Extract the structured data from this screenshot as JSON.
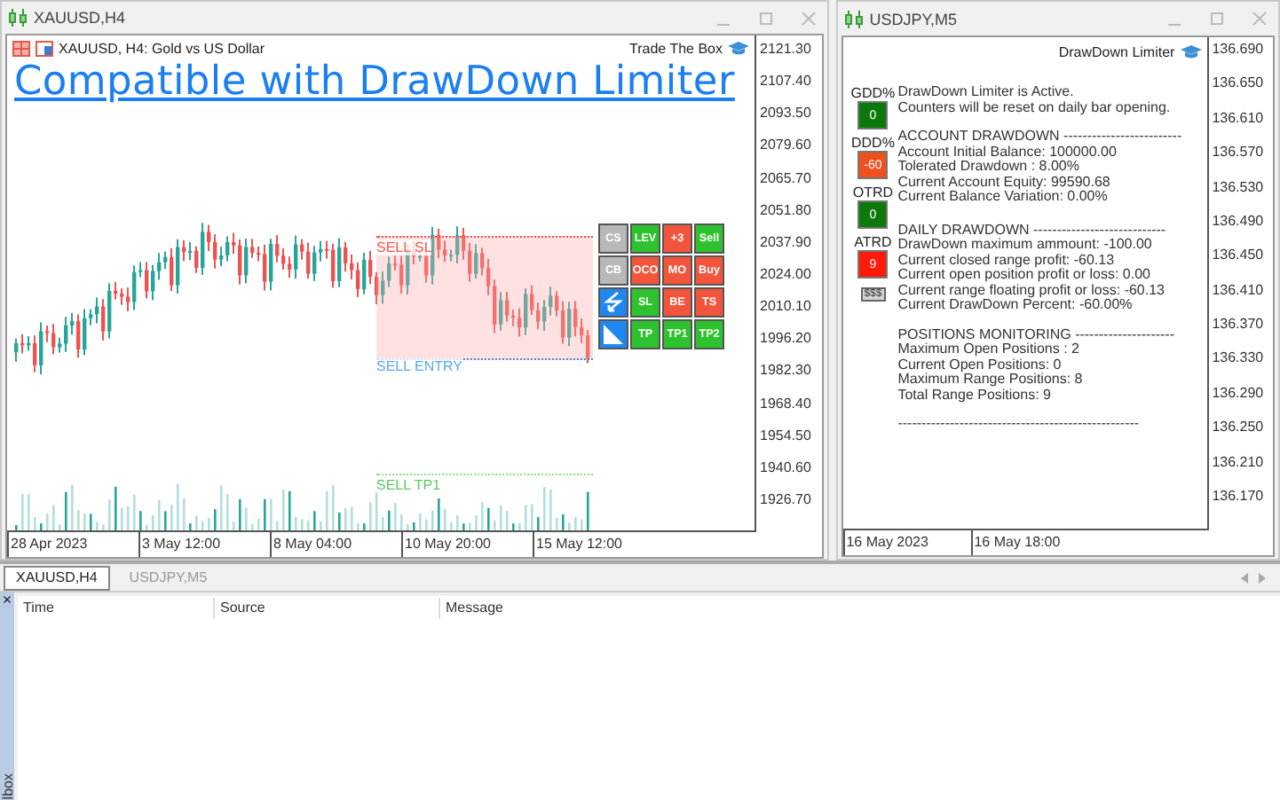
{
  "left_window": {
    "title": "XAUUSD,H4",
    "symbol_info": "XAUUSD, H4:  Gold vs US Dollar",
    "brand": "Trade The Box",
    "banner": "Compatible with DrawDown Limiter",
    "price_axis": [
      "2121.30",
      "2107.40",
      "2093.50",
      "2079.60",
      "2065.70",
      "2051.80",
      "2037.90",
      "2024.00",
      "2010.10",
      "1996.20",
      "1982.30",
      "1968.40",
      "1954.50",
      "1940.60",
      "1926.70"
    ],
    "time_axis": [
      "28 Apr 2023",
      "3 May 12:00",
      "8 May 04:00",
      "10 May 20:00",
      "15 May 12:00"
    ],
    "trade_lines": [
      {
        "label": "SELL SL",
        "kind": "sl"
      },
      {
        "label": "SELL ENTRY",
        "kind": "entry"
      },
      {
        "label": "SELL TP1",
        "kind": "tp"
      }
    ],
    "buttons": [
      {
        "kind": "text",
        "label": "CS",
        "color": "#b8b8b8"
      },
      {
        "kind": "text",
        "label": "LEV",
        "color": "#2ec22e"
      },
      {
        "kind": "text",
        "label": "+3",
        "color": "#f2553c"
      },
      {
        "kind": "text",
        "label": "Sell",
        "color": "#2ec22e"
      },
      {
        "kind": "text",
        "label": "CB",
        "color": "#b8b8b8"
      },
      {
        "kind": "text",
        "label": "OCO",
        "color": "#f2553c"
      },
      {
        "kind": "text",
        "label": "MO",
        "color": "#f2553c"
      },
      {
        "kind": "text",
        "label": "Buy",
        "color": "#f2553c"
      },
      {
        "kind": "zigzag",
        "color": "#1e88f0"
      },
      {
        "kind": "text",
        "label": "SL",
        "color": "#2ec22e"
      },
      {
        "kind": "text",
        "label": "BE",
        "color": "#f2553c"
      },
      {
        "kind": "text",
        "label": "TS",
        "color": "#f2553c"
      },
      {
        "kind": "triangle",
        "color": "#1e88f0"
      },
      {
        "kind": "text",
        "label": "TP",
        "color": "#2ec22e"
      },
      {
        "kind": "text",
        "label": "TP1",
        "color": "#2ec22e"
      },
      {
        "kind": "text",
        "label": "TP2",
        "color": "#2ec22e"
      }
    ]
  },
  "right_window": {
    "title": "USDJPY,M5",
    "brand": "DrawDown Limiter",
    "price_axis": [
      "136.690",
      "136.650",
      "136.610",
      "136.570",
      "136.530",
      "136.490",
      "136.450",
      "136.410",
      "136.370",
      "136.330",
      "136.290",
      "136.250",
      "136.210",
      "136.170"
    ],
    "time_axis": [
      "16 May 2023",
      "16 May 18:00"
    ],
    "indicators": [
      {
        "label": "GDD%",
        "value": "0",
        "color": "#0b7a0b",
        "kind": "box"
      },
      {
        "label": "DDD%",
        "value": "-60",
        "color": "#f0501e",
        "kind": "box"
      },
      {
        "label": "OTRD",
        "value": "0",
        "color": "#0b7a0b",
        "kind": "box"
      },
      {
        "label": "ATRD",
        "value": "9",
        "color": "#ff1a0a",
        "kind": "box"
      },
      {
        "value": "$$$",
        "color": "#d4d4d4",
        "kind": "tag"
      }
    ],
    "messages": [
      "DrawDown Limiter is Active.",
      "Counters will be reset on daily bar opening."
    ],
    "sections": [
      {
        "heading": "ACCOUNT DRAWDOWN -------------------------",
        "lines": [
          "Account Initial Balance: 100000.00",
          "Tolerated Drawdown : 8.00%",
          "Current Account Equity: 99590.68",
          "Current Balance Variation: 0.00%"
        ]
      },
      {
        "heading": "DAILY DRAWDOWN ----------------------------",
        "lines": [
          "DrawDown maximum ammount: -100.00",
          "Current closed range profit: -60.13",
          "Current open position profit or loss: 0.00",
          "Current range floating profit or loss: -60.13",
          "Current DrawDown Percent: -60.00%"
        ]
      },
      {
        "heading": "POSITIONS MONITORING ---------------------",
        "lines": [
          "Maximum Open Positions : 2",
          "Current Open Positions: 0",
          "Maximum Range Positions: 8",
          "Total Range Positions: 9"
        ]
      }
    ],
    "footer_rule": "---------------------------------------------------"
  },
  "chart_tabs": [
    {
      "label": "XAUUSD,H4",
      "selected": true
    },
    {
      "label": "USDJPY,M5",
      "selected": false
    }
  ],
  "toolbox": {
    "side_label": "lbox",
    "close": "×",
    "columns": [
      "Time",
      "Source",
      "Message"
    ]
  }
}
